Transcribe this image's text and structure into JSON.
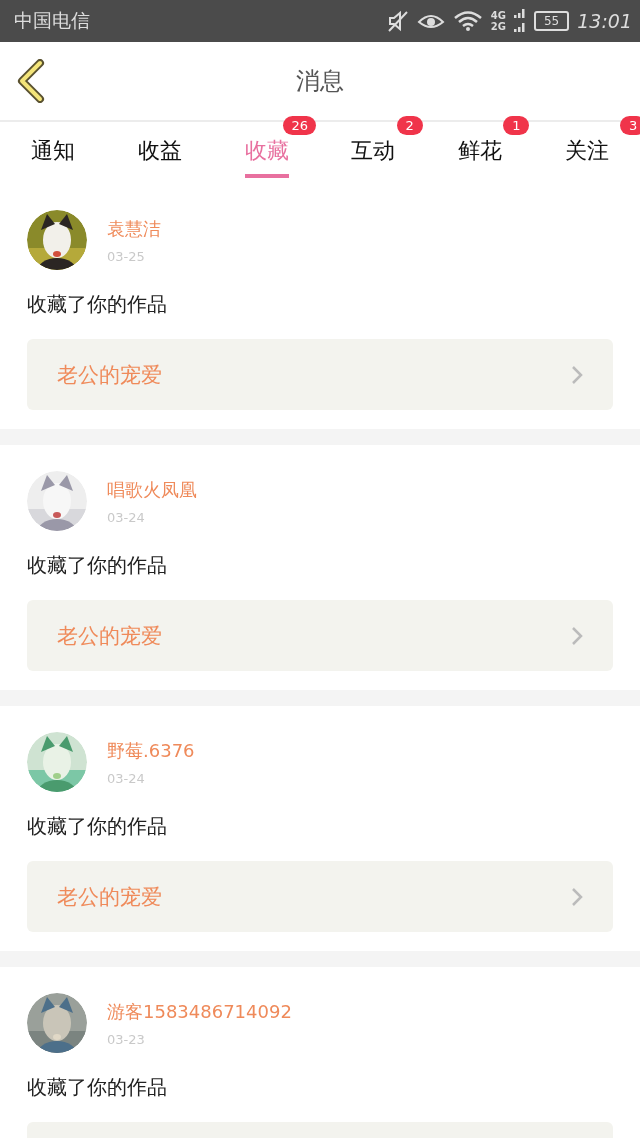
{
  "status_bar": {
    "carrier": "中国电信",
    "battery": "55",
    "time": "13:01",
    "network_top": "4G",
    "network_bottom": "2G"
  },
  "header": {
    "title": "消息"
  },
  "tabs": [
    {
      "label": "通知",
      "selected": false
    },
    {
      "label": "收益",
      "selected": false
    },
    {
      "label": "收藏",
      "selected": true,
      "badge": "26"
    },
    {
      "label": "互动",
      "selected": false,
      "badge": "2"
    },
    {
      "label": "鲜花",
      "selected": false,
      "badge": "1"
    },
    {
      "label": "关注",
      "selected": false,
      "badge": "3"
    }
  ],
  "messages": [
    {
      "name": "袁慧洁",
      "date": "03-25",
      "text": "收藏了你的作品",
      "work": "老公的宠爱"
    },
    {
      "name": "唱歌火凤凰",
      "date": "03-24",
      "text": "收藏了你的作品",
      "work": "老公的宠爱"
    },
    {
      "name": "野莓.6376",
      "date": "03-24",
      "text": "收藏了你的作品",
      "work": "老公的宠爱"
    },
    {
      "name": "游客1583486714092",
      "date": "03-23",
      "text": "收藏了你的作品"
    }
  ]
}
